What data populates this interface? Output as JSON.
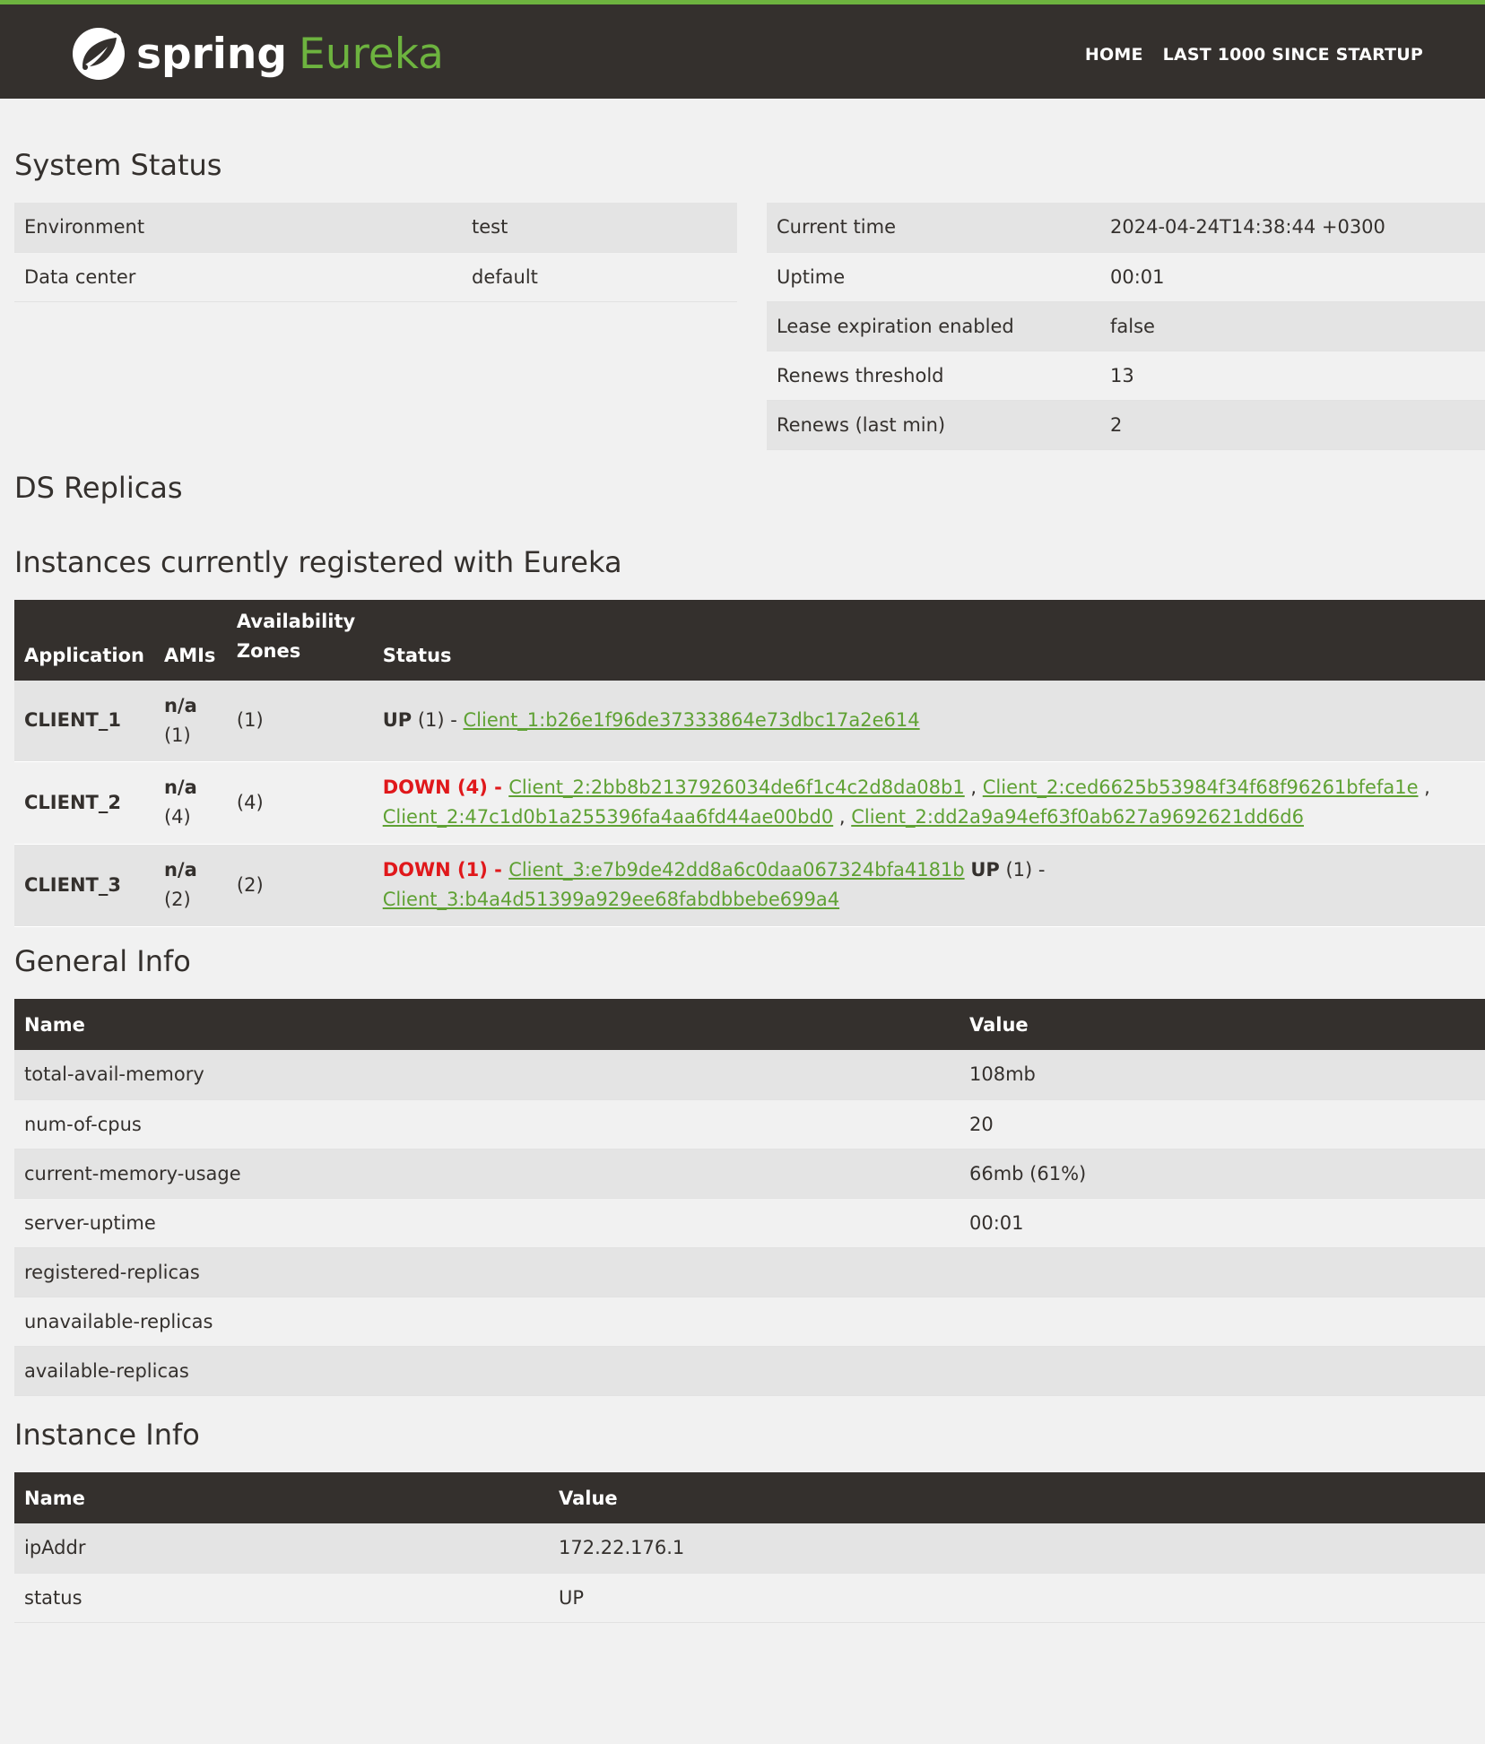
{
  "header": {
    "brand_spring": "spring",
    "brand_eureka": "Eureka",
    "nav": [
      "HOME",
      "LAST 1000 SINCE STARTUP"
    ],
    "colors": {
      "accent": "#6db33f",
      "navbar": "#34302d"
    }
  },
  "system_status": {
    "title": "System Status",
    "left": [
      {
        "label": "Environment",
        "value": "test"
      },
      {
        "label": "Data center",
        "value": "default"
      }
    ],
    "right": [
      {
        "label": "Current time",
        "value": "2024-04-24T14:38:44 +0300"
      },
      {
        "label": "Uptime",
        "value": "00:01"
      },
      {
        "label": "Lease expiration enabled",
        "value": "false"
      },
      {
        "label": "Renews threshold",
        "value": "13"
      },
      {
        "label": "Renews (last min)",
        "value": "2"
      }
    ]
  },
  "ds_replicas": {
    "title": "DS Replicas"
  },
  "instances": {
    "title": "Instances currently registered with Eureka",
    "headers": [
      "Application",
      "AMIs",
      "Availability Zones",
      "Status"
    ],
    "rows": [
      {
        "application": "CLIENT_1",
        "amis": "n/a",
        "amis_count": "(1)",
        "zones": "(1)",
        "status_up": "UP",
        "status_up_count": " (1) - ",
        "links": [
          "Client_1:b26e1f96de37333864e73dbc17a2e614"
        ]
      },
      {
        "application": "CLIENT_2",
        "amis": "n/a",
        "amis_count": "(4)",
        "zones": "(4)",
        "status_down": "DOWN (4) - ",
        "links": [
          "Client_2:2bb8b2137926034de6f1c4c2d8da08b1",
          "Client_2:ced6625b53984f34f68f96261bfefa1e",
          "Client_2:47c1d0b1a255396fa4aa6fd44ae00bd0",
          "Client_2:dd2a9a94ef63f0ab627a9692621dd6d6"
        ],
        "separator": " , "
      },
      {
        "application": "CLIENT_3",
        "amis": "n/a",
        "amis_count": "(2)",
        "zones": "(2)",
        "status_down": "DOWN (1) - ",
        "down_link": "Client_3:e7b9de42dd8a6c0daa067324bfa4181b",
        "status_up": "UP",
        "status_up_count": " (1) - ",
        "up_link": "Client_3:b4a4d51399a929ee68fabdbbebe699a4"
      }
    ]
  },
  "general_info": {
    "title": "General Info",
    "headers": [
      "Name",
      "Value"
    ],
    "rows": [
      {
        "name": "total-avail-memory",
        "value": "108mb"
      },
      {
        "name": "num-of-cpus",
        "value": "20"
      },
      {
        "name": "current-memory-usage",
        "value": "66mb (61%)"
      },
      {
        "name": "server-uptime",
        "value": "00:01"
      },
      {
        "name": "registered-replicas",
        "value": ""
      },
      {
        "name": "unavailable-replicas",
        "value": ""
      },
      {
        "name": "available-replicas",
        "value": ""
      }
    ]
  },
  "instance_info": {
    "title": "Instance Info",
    "headers": [
      "Name",
      "Value"
    ],
    "rows": [
      {
        "name": "ipAddr",
        "value": "172.22.176.1"
      },
      {
        "name": "status",
        "value": "UP"
      }
    ]
  },
  "status_colors": {
    "down": "#e0181b",
    "link": "#5fa134"
  }
}
